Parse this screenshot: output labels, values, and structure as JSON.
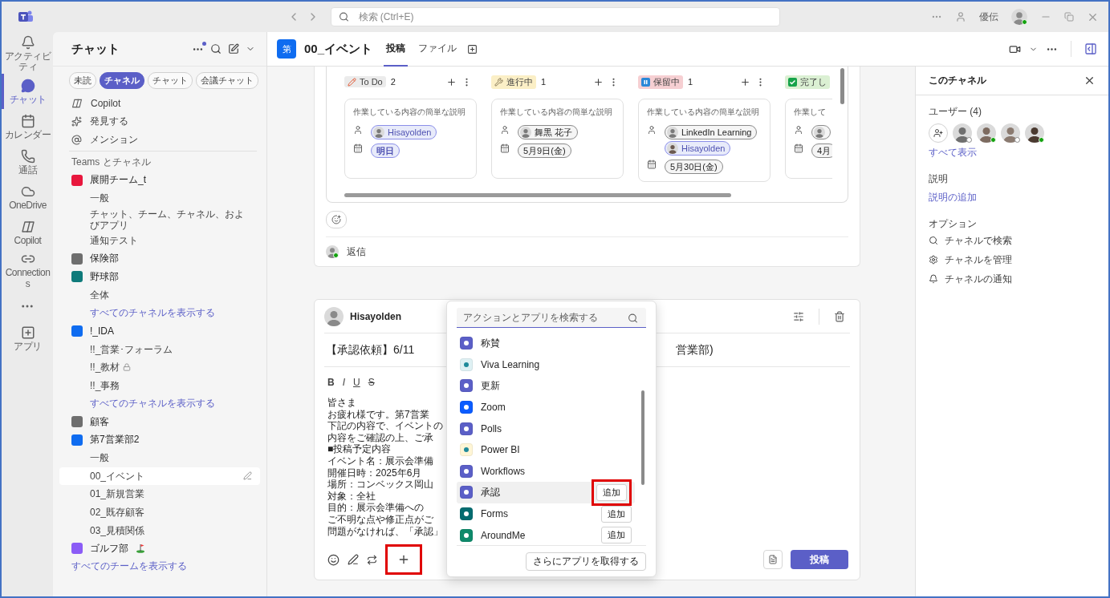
{
  "title_bar": {
    "search_placeholder": "検索 (Ctrl+E)",
    "user_name": "優伝",
    "online": true
  },
  "rail": [
    {
      "label": "アクティビティ",
      "selected": false
    },
    {
      "label": "チャット",
      "selected": true
    },
    {
      "label": "カレンダー",
      "selected": false
    },
    {
      "label": "通話",
      "selected": false
    },
    {
      "label": "OneDrive",
      "selected": false
    },
    {
      "label": "Copilot",
      "selected": false
    },
    {
      "label": "Connections",
      "selected": false
    },
    {
      "label": "アプリ",
      "selected": false
    }
  ],
  "sidebar": {
    "title": "チャット",
    "unread_dot": true,
    "filters": [
      {
        "label": "未読",
        "selected": false
      },
      {
        "label": "チャネル",
        "selected": true
      },
      {
        "label": "チャット",
        "selected": false
      },
      {
        "label": "会議チャット",
        "selected": false
      }
    ],
    "shortcuts": [
      "Copilot",
      "発見する",
      "メンション"
    ],
    "section_title": "Teams とチャネル",
    "teams": [
      {
        "name": "展開チーム_t",
        "color": "#e8173d",
        "children": [
          {
            "name": "一般",
            "selected": false,
            "locked": false
          },
          {
            "name": "チャット、チーム、チャネル、およびアプリ",
            "selected": false,
            "locked": false
          },
          {
            "name": "通知テスト",
            "selected": false,
            "locked": false
          }
        ]
      },
      {
        "name": "保険部",
        "color": "#6e6e6e"
      },
      {
        "name": "野球部",
        "color": "#0f7b7b",
        "children": [
          {
            "name": "全体",
            "selected": false,
            "locked": false
          }
        ],
        "show_all": "すべてのチャネルを表示する"
      },
      {
        "name": "!_IDA",
        "color": "#0f6cf0",
        "children": [
          {
            "name": "!!_営業･フォーラム",
            "selected": false,
            "locked": false
          },
          {
            "name": "!!_教材",
            "selected": false,
            "locked": true
          },
          {
            "name": "!!_事務",
            "selected": false,
            "locked": false
          }
        ],
        "show_all": "すべてのチャネルを表示する"
      },
      {
        "name": "顧客",
        "color": "#6e6e6e"
      },
      {
        "name": "第7営業部2",
        "color": "#0f6cf0",
        "children": [
          {
            "name": "一般",
            "selected": false,
            "locked": false
          },
          {
            "name": "00_イベント",
            "selected": true,
            "locked": false
          },
          {
            "name": "01_新規営業",
            "selected": false,
            "locked": false
          },
          {
            "name": "02_既存顧客",
            "selected": false,
            "locked": false
          },
          {
            "name": "03_見積関係",
            "selected": false,
            "locked": false
          }
        ]
      },
      {
        "name": "ゴルフ部",
        "color": "#8b5cf6",
        "golf": true
      }
    ],
    "show_all_teams": "すべてのチームを表示する"
  },
  "channel": {
    "team_initial": "第",
    "name": "00_イベント",
    "tabs": [
      {
        "label": "投稿",
        "selected": true
      },
      {
        "label": "ファイル",
        "selected": false
      }
    ]
  },
  "board": {
    "columns": [
      {
        "kind": "todo",
        "label": "To Do",
        "count": "2",
        "cards": [
          {
            "description": "作業している内容の簡単な説明",
            "assignees": [
              {
                "name": "Hisayolden",
                "emphasized": true
              }
            ],
            "due": "明日",
            "due_emphasized": true
          }
        ]
      },
      {
        "kind": "progress",
        "label": "進行中",
        "count": "1",
        "cards": [
          {
            "description": "作業している内容の簡単な説明",
            "assignees": [
              {
                "name": "舞黒 花子",
                "emphasized": false
              }
            ],
            "due": "5月9日(金)",
            "due_emphasized": false
          }
        ]
      },
      {
        "kind": "hold",
        "label": "保留中",
        "count": "1",
        "cards": [
          {
            "description": "作業している内容の簡単な説明",
            "assignees": [
              {
                "name": "LinkedIn Learning",
                "emphasized": false
              },
              {
                "name": "Hisayolden",
                "emphasized": true
              }
            ],
            "due": "5月30日(金)",
            "due_emphasized": false
          }
        ]
      },
      {
        "kind": "done",
        "label": "完了し",
        "cards": [
          {
            "description": "作業して",
            "assignees": [
              {
                "emphasized": false
              }
            ],
            "due": "4月",
            "due_emphasized": false
          }
        ]
      }
    ]
  },
  "post": {
    "reply_label": "返信",
    "author_online": true
  },
  "composer": {
    "author": "Hisayolden",
    "subject_start": "【承認依頼】6/11",
    "subject_end": "営業部)",
    "format_buttons": [
      "B",
      "I",
      "U",
      "S"
    ],
    "body_lines": [
      "皆さま",
      "お疲れ様です。第7営業",
      "下記の内容で、イベントの",
      "内容をご確認の上、ご承",
      "■投稿予定内容",
      "イベント名：展示会準備",
      "開催日時：2025年6月",
      "場所：コンベックス岡山",
      "対象：全社",
      "目的：展示会準備への",
      "ご不明な点や修正点がご",
      "問題がなければ、「承認」"
    ],
    "plus_highlighted": true,
    "post_button": "投稿"
  },
  "app_menu": {
    "search_placeholder": "アクションとアプリを検索する",
    "apps": [
      {
        "name": "称賛",
        "color": "#5b5fc7",
        "selected": false
      },
      {
        "name": "Viva Learning",
        "color": "#dff1f4",
        "selected": false
      },
      {
        "name": "更新",
        "color": "#5b5fc7",
        "selected": false
      },
      {
        "name": "Zoom",
        "color": "#0b5cff",
        "selected": false
      },
      {
        "name": "Polls",
        "color": "#5b5fc7",
        "selected": false
      },
      {
        "name": "Power BI",
        "color": "#fff6d6",
        "selected": false
      },
      {
        "name": "Workflows",
        "color": "#5b5fc7",
        "selected": false
      },
      {
        "name": "承認",
        "color": "#5b5fc7",
        "selected": true,
        "add": "追加",
        "highlighted": true
      },
      {
        "name": "Forms",
        "color": "#036c70",
        "selected": false,
        "add": "追加",
        "highlighted": false
      },
      {
        "name": "AroundMe",
        "color": "#0e8a6b",
        "selected": false,
        "add": "追加",
        "highlighted": false
      }
    ],
    "more_apps": "さらにアプリを取得する"
  },
  "right_panel": {
    "title": "このチャネル",
    "users_label": "ユーザー (4)",
    "members": [
      {
        "online": false
      },
      {
        "online": true
      },
      {
        "online": false
      },
      {
        "online": true
      }
    ],
    "show_all": "すべて表示",
    "description_label": "説明",
    "add_description": "説明の追加",
    "options_label": "オプション",
    "options": [
      "チャネルで検索",
      "チャネルを管理",
      "チャネルの通知"
    ]
  }
}
